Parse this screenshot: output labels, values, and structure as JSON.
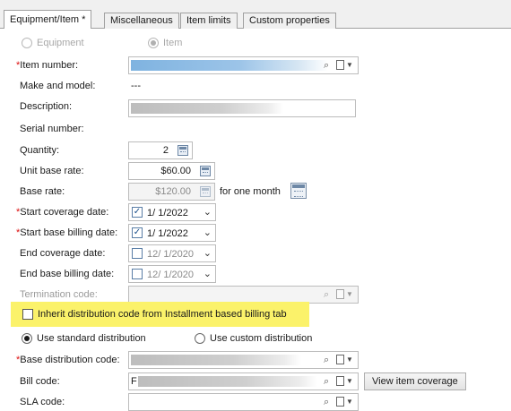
{
  "tabs": [
    {
      "label": "Equipment/Item *",
      "active": true
    },
    {
      "label": "Miscellaneous",
      "active": false
    },
    {
      "label": "Item limits",
      "active": false
    },
    {
      "label": "Custom properties",
      "active": false
    }
  ],
  "type_selector": {
    "options": [
      {
        "label": "Equipment",
        "selected": false,
        "enabled": false
      },
      {
        "label": "Item",
        "selected": true,
        "enabled": false
      }
    ]
  },
  "fields": {
    "item_number": {
      "label": "Item number:",
      "required": true
    },
    "make_model": {
      "label": "Make and model:",
      "value": "---"
    },
    "description": {
      "label": "Description:"
    },
    "serial_number": {
      "label": "Serial number:"
    },
    "quantity": {
      "label": "Quantity:",
      "value": "2"
    },
    "unit_base_rate": {
      "label": "Unit base rate:",
      "value": "$60.00"
    },
    "base_rate": {
      "label": "Base rate:",
      "value": "$120.00",
      "suffix": "for one month"
    },
    "start_coverage_date": {
      "label": "Start coverage date:",
      "required": true,
      "checked": true,
      "value": "1/  1/2022"
    },
    "start_base_billing_date": {
      "label": "Start base billing date:",
      "required": true,
      "checked": true,
      "value": "1/  1/2022"
    },
    "end_coverage_date": {
      "label": "End coverage date:",
      "checked": false,
      "value": "12/  1/2020"
    },
    "end_base_billing_date": {
      "label": "End base billing date:",
      "checked": false,
      "value": "12/  1/2020"
    },
    "termination_code": {
      "label": "Termination code:",
      "enabled": false
    },
    "base_distribution_code": {
      "label": "Base distribution code:",
      "required": true
    },
    "bill_code": {
      "label": "Bill code:",
      "value_prefix": "F"
    },
    "sla_code": {
      "label": "SLA code:"
    }
  },
  "inherit_checkbox": {
    "label": "Inherit distribution code from Installment based billing tab",
    "checked": false,
    "highlight_color": "#fbf26a"
  },
  "distribution": {
    "options": [
      {
        "label": "Use standard distribution",
        "selected": true
      },
      {
        "label": "Use custom distribution",
        "selected": false
      }
    ]
  },
  "buttons": {
    "view_item_coverage": "View item coverage"
  },
  "required_marker": "*",
  "colors": {
    "required": "#dd1111",
    "tab_background": "#f0f0f0",
    "redacted_blue": "#7fb3e0"
  }
}
